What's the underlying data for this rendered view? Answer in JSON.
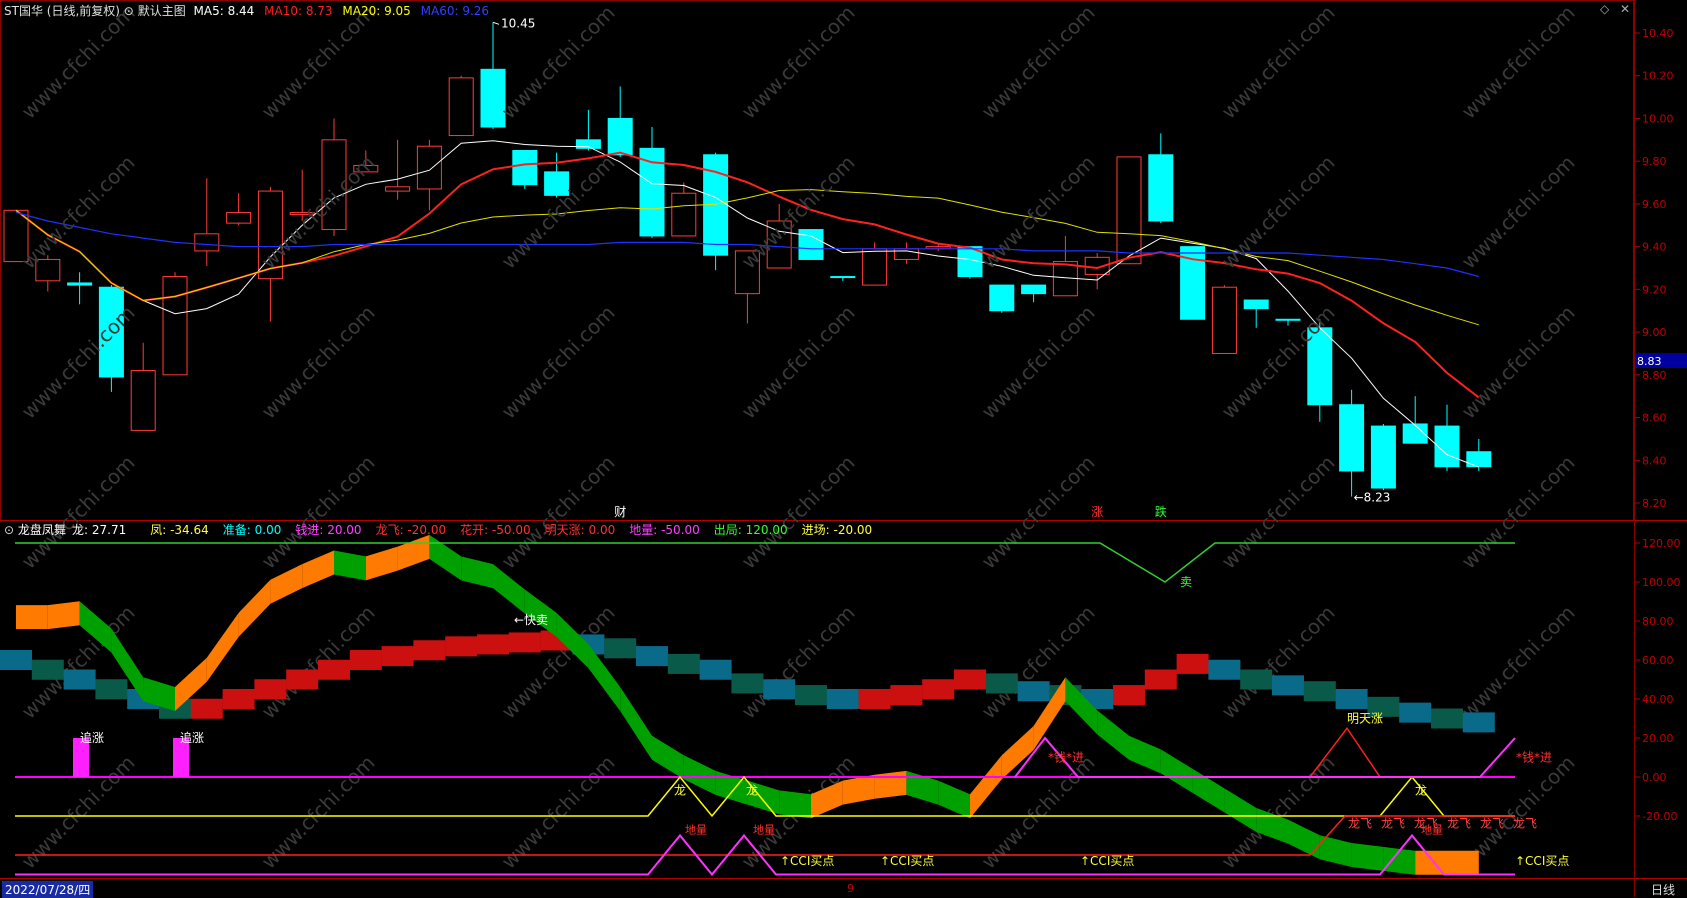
{
  "header": {
    "stock_name": "ST国华",
    "period_mode": "(日线,前复权)",
    "template_icon": "toggle-icon",
    "template_name": "默认主图",
    "ma5": "MA5: 8.44",
    "ma10": "MA10: 8.73",
    "ma20": "MA20: 9.05",
    "ma60": "MA60: 9.26",
    "colors": {
      "ma5": "#ffffff",
      "ma10": "#ff2020",
      "ma20": "#ffff00",
      "ma60": "#3040ff"
    }
  },
  "price_panel": {
    "high_label": "10.45",
    "low_label": "←8.23",
    "current_price": "8.83",
    "axis_ticks": [
      "10.40",
      "10.20",
      "10.00",
      "9.80",
      "9.60",
      "9.40",
      "9.20",
      "9.00",
      "8.80",
      "8.60",
      "8.40",
      "8.20"
    ],
    "markers": [
      {
        "text": "财",
        "color": "#ffffff"
      },
      {
        "text": "涨",
        "color": "#ff3030"
      },
      {
        "text": "跌",
        "color": "#30ff30"
      }
    ],
    "watermark": "www.cfchi.com"
  },
  "indicator_header": {
    "name": "龙盘凤舞",
    "values": [
      {
        "text": "龙: 27.71",
        "color": "#ffffff"
      },
      {
        "text": "凤: -34.64",
        "color": "#ffff40"
      },
      {
        "text": "准备: 0.00",
        "color": "#00ffff"
      },
      {
        "text": "钱进: 20.00",
        "color": "#ff40ff"
      },
      {
        "text": "龙飞: -20.00",
        "color": "#ff3030"
      },
      {
        "text": "花开: -50.00",
        "color": "#ff3030"
      },
      {
        "text": "明天涨: 0.00",
        "color": "#ff3030"
      },
      {
        "text": "地量: -50.00",
        "color": "#ff40ff"
      },
      {
        "text": "出局: 120.00",
        "color": "#30ff30"
      },
      {
        "text": "进场: -20.00",
        "color": "#ffff40"
      }
    ]
  },
  "indicator_panel": {
    "axis_ticks": [
      "120.00",
      "100.00",
      "80.00",
      "60.00",
      "40.00",
      "20.00",
      "0.00",
      "-20.00"
    ],
    "labels": {
      "chase_1": "追涨",
      "chase_2": "追涨",
      "fast_sell": "←快卖",
      "sell": "卖",
      "dragon_1": "龙",
      "dragon_2": "龙",
      "dragon_3": "龙",
      "ground_1": "地量",
      "ground_2": "地量",
      "ground_3": "地量",
      "cci_1": "↑CCI买点",
      "cci_2": "↑CCI买点",
      "cci_3": "↑CCI买点",
      "cci_4": "↑CCI买点",
      "money_in_1": "*钱*进",
      "money_in_2": "*钱*进",
      "tomorrow_up": "明天涨",
      "dragon_fly": [
        "龙飞",
        "龙飞",
        "龙飞",
        "龙飞",
        "龙飞",
        "龙飞"
      ]
    }
  },
  "footer": {
    "date": "2022/07/28/四",
    "period": "日线",
    "mid_mark": "9"
  }
}
